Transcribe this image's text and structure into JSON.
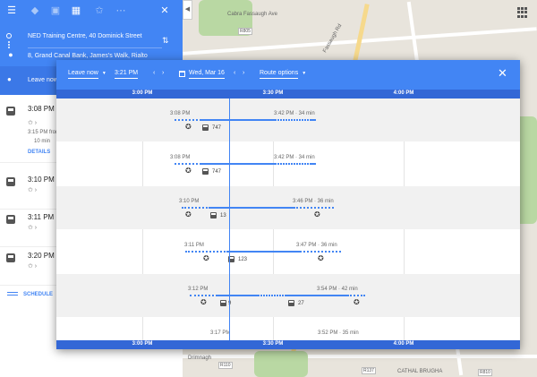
{
  "origin": "NED Training Centre, 40 Dominick Street",
  "destination": "8, Grand Canal Bank, James's Walk, Rialto",
  "panel": {
    "leave_label": "Leave now",
    "details_label": "DETAILS",
    "schedules_label": "SCHEDULE",
    "routes": [
      {
        "time": "3:08 PM",
        "sub": "3:15 PM from",
        "walk": "10 min"
      },
      {
        "time": "3:10 PM"
      },
      {
        "time": "3:11 PM"
      },
      {
        "time": "3:20 PM"
      }
    ]
  },
  "dialog": {
    "leave_option": "Leave now",
    "time_value": "3:21 PM",
    "date_value": "Wed, Mar 16",
    "route_options_label": "Route options",
    "axis_labels": [
      "3:00 PM",
      "3:30 PM",
      "4:00 PM"
    ]
  },
  "timeline": [
    {
      "depart": "3:08 PM",
      "arrive": "3:42 PM · 34 min",
      "bus": "747"
    },
    {
      "depart": "3:08 PM",
      "arrive": "3:42 PM · 34 min",
      "bus": "747"
    },
    {
      "depart": "3:10 PM",
      "arrive": "3:46 PM · 36 min",
      "bus": "13"
    },
    {
      "depart": "3:11 PM",
      "arrive": "3:47 PM · 36 min",
      "bus": "123"
    },
    {
      "depart": "3:12 PM",
      "arrive": "3:54 PM · 42 min",
      "bus": "9",
      "bus2": "27"
    },
    {
      "depart": "3:17 PM",
      "arrive": "3:52 PM · 35 min"
    }
  ],
  "map": {
    "street_cabra": "Cabra Fassaugh Ave",
    "street_fassaugh": "Fassaugh Rd",
    "street_drimnagh": "Drimnagh",
    "street_cathal": "CATHAL BRUGHA",
    "road_r805": "R805",
    "road_r810": "R810",
    "road_r137": "R137",
    "road_r110": "R110"
  },
  "colors": {
    "accent": "#4285f4",
    "accent_dark": "#3367d6"
  }
}
